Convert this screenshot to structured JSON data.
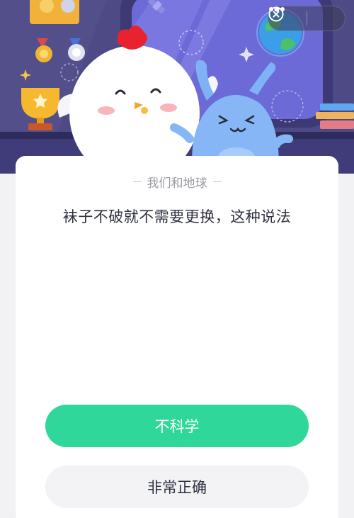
{
  "header": {
    "more_icon": "more-dots-icon",
    "close_icon": "close-circle-icon"
  },
  "quiz": {
    "category": "我们和地球",
    "question": "袜子不破就不需要更换，这种说法",
    "options": [
      {
        "label": "不科学",
        "style": "primary"
      },
      {
        "label": "非常正确",
        "style": "secondary"
      }
    ]
  },
  "colors": {
    "banner_bg": "#4e4a86",
    "primary_button": "#2fd89a",
    "secondary_button": "#f3f3f6",
    "text_main": "#2f3140",
    "text_muted": "#9a9aa4"
  }
}
